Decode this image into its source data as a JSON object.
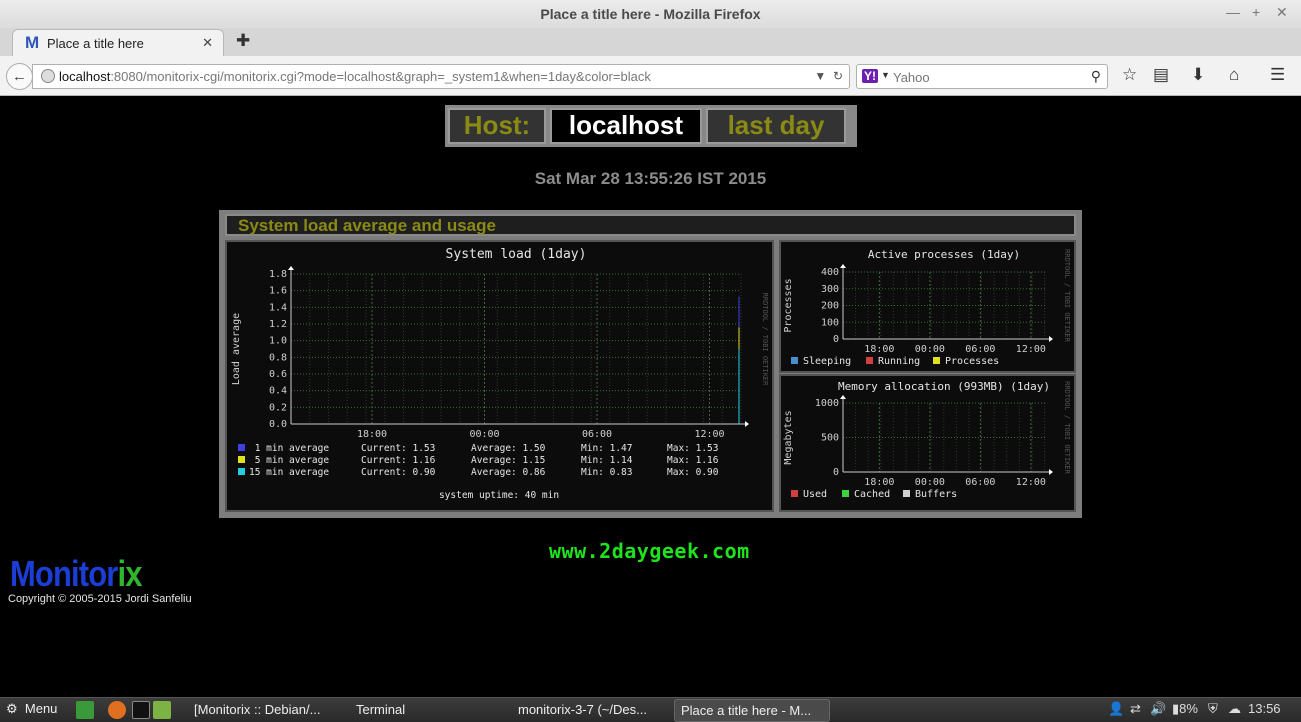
{
  "window": {
    "title": "Place a title here - Mozilla Firefox"
  },
  "tab": {
    "label": "Place a title here",
    "favicon_letter": "M"
  },
  "nav": {
    "url_host": "localhost",
    "url_rest": ":8080/monitorix-cgi/monitorix.cgi?mode=localhost&graph=_system1&when=1day&color=black",
    "search_placeholder": "Yahoo"
  },
  "header": {
    "host_label": "Host:",
    "host_value": "localhost",
    "period": "last day"
  },
  "timestamp": "Sat Mar 28 13:55:26 IST 2015",
  "panel_title": "System load average and usage",
  "rrd_credit": "RRDTOOL / TOBI OETIKER",
  "chart_data": [
    {
      "type": "line",
      "title": "System load  (1day)",
      "ylabel": "Load average",
      "ylim": [
        0,
        1.8
      ],
      "yticks": [
        "1.8",
        "1.6",
        "1.4",
        "1.2",
        "1.0",
        "0.8",
        "0.6",
        "0.4",
        "0.2",
        "0.0"
      ],
      "xticks": [
        "18:00",
        "00:00",
        "06:00",
        "12:00"
      ],
      "series": [
        {
          "name": "1 min average",
          "color": "#4040e0",
          "current": "1.53",
          "average": "1.50",
          "min": "1.47",
          "max": "1.53"
        },
        {
          "name": "5 min average",
          "color": "#e0e020",
          "current": "1.16",
          "average": "1.15",
          "min": "1.14",
          "max": "1.16"
        },
        {
          "name": "15 min average",
          "color": "#20d0e0",
          "current": "0.90",
          "average": "0.86",
          "min": "0.83",
          "max": "0.90"
        }
      ],
      "stat_labels": {
        "current": "Current:",
        "average": "Average:",
        "min": "Min:",
        "max": "Max:"
      },
      "footer": "system uptime:  40 min"
    },
    {
      "type": "area",
      "title": "Active processes  (1day)",
      "ylabel": "Processes",
      "ylim": [
        0,
        400
      ],
      "yticks": [
        "400",
        "300",
        "200",
        "100",
        "0"
      ],
      "xticks": [
        "18:00",
        "00:00",
        "06:00",
        "12:00"
      ],
      "series": [
        {
          "name": "Sleeping",
          "color": "#4b8fd0"
        },
        {
          "name": "Running",
          "color": "#d04040"
        },
        {
          "name": "Processes",
          "color": "#e0e020"
        }
      ]
    },
    {
      "type": "area",
      "title": "Memory allocation (993MB)  (1day)",
      "ylabel": "Megabytes",
      "ylim": [
        0,
        1000
      ],
      "yticks": [
        "1000",
        "500",
        "0"
      ],
      "xticks": [
        "18:00",
        "00:00",
        "06:00",
        "12:00"
      ],
      "series": [
        {
          "name": "Used",
          "color": "#d04040"
        },
        {
          "name": "Cached",
          "color": "#40d040"
        },
        {
          "name": "Buffers",
          "color": "#d0d0d0"
        }
      ]
    }
  ],
  "watermark": "www.2daygeek.com",
  "logo": {
    "part1": "Monitor",
    "part2": "ix"
  },
  "copyright": "Copyright © 2005-2015 Jordi Sanfeliu",
  "taskbar": {
    "menu": "Menu",
    "tasks": [
      "[Monitorix :: Debian/...",
      "Terminal",
      "monitorix-3-7 (~/Des...",
      "Place a title here - M..."
    ],
    "battery": "8%",
    "clock": "13:56"
  }
}
